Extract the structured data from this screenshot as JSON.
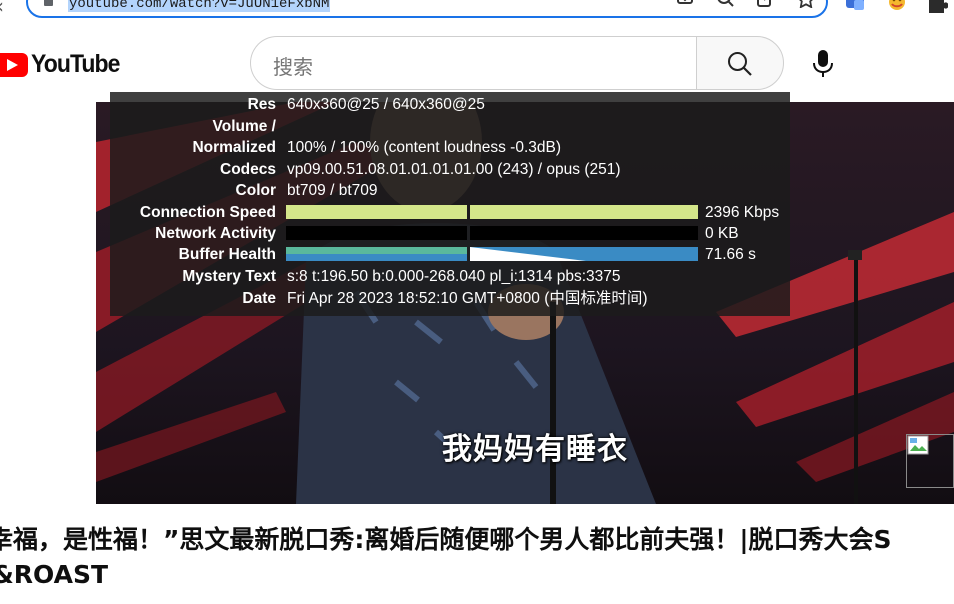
{
  "browser": {
    "url": "youtube.com/watch?v=JuUN1eFxbNM",
    "icons": [
      "install-app-icon",
      "zoom-icon",
      "share-icon",
      "bookmark-star-icon",
      "extension-translate-icon",
      "extension-emoji-icon",
      "extensions-puzzle-icon"
    ]
  },
  "header": {
    "logo_text": "YouTube",
    "search_placeholder": "搜索"
  },
  "stats": {
    "res": {
      "label": "Res",
      "value": "640x360@25 / 640x360@25"
    },
    "volume": {
      "label": "Volume /",
      "value": ""
    },
    "normalized": {
      "label": "Normalized",
      "value": "100% / 100% (content loudness -0.3dB)"
    },
    "codecs": {
      "label": "Codecs",
      "value": "vp09.00.51.08.01.01.01.01.00 (243) / opus (251)"
    },
    "color": {
      "label": "Color",
      "value": "bt709 / bt709"
    },
    "connection_speed": {
      "label": "Connection Speed",
      "value": "2396 Kbps"
    },
    "network_activity": {
      "label": "Network Activity",
      "value": "0 KB"
    },
    "buffer_health": {
      "label": "Buffer Health",
      "value": "71.66 s"
    },
    "mystery_text": {
      "label": "Mystery Text",
      "value": "s:8 t:196.50 b:0.000-268.040 pl_i:1314 pbs:3375"
    },
    "date": {
      "label": "Date",
      "value": "Fri Apr 28 2023 18:52:10 GMT+0800 (中国标准时间)"
    },
    "colors": {
      "connection_bar": "#d4e68a",
      "buffer_bar": "#3a8bc4",
      "buffer_accent": "#5ab89c"
    }
  },
  "video": {
    "subtitle": "我妈妈有睡衣"
  },
  "title": {
    "line1": "幸福，是性福！”思文最新脱口秀:离婚后随便哪个男人都比前夫强！|脱口秀大会S",
    "line2": "&ROAST"
  }
}
